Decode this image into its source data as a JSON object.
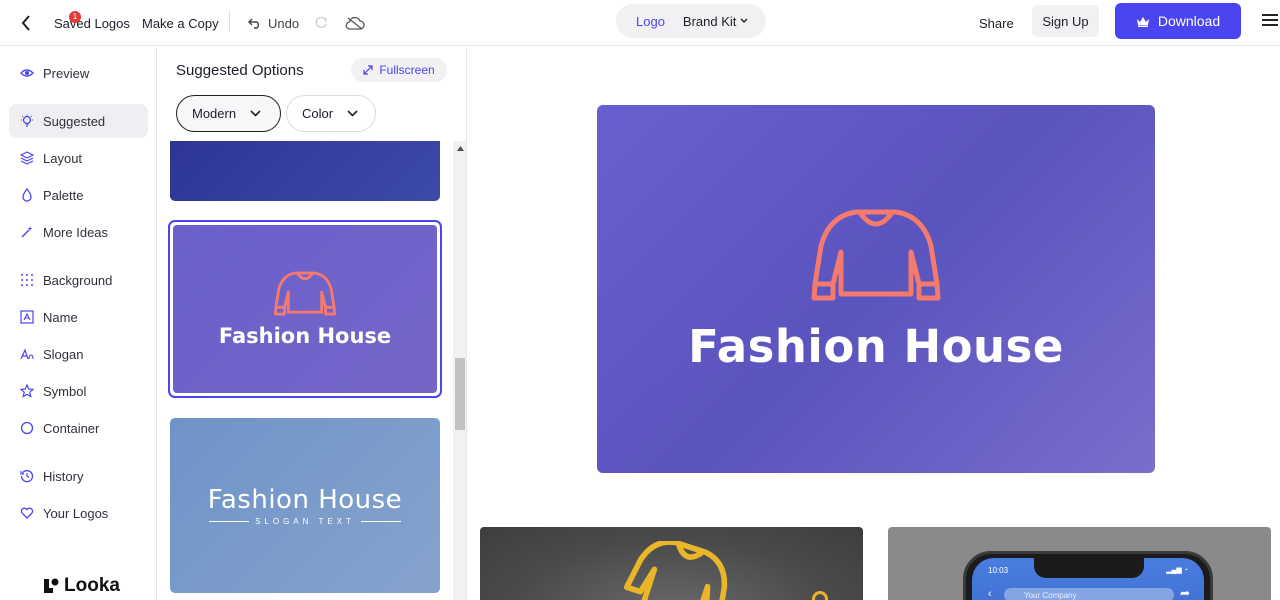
{
  "topbar": {
    "saved_label": "Saved Logos",
    "saved_badge": "1",
    "copy_label": "Make a Copy",
    "undo_label": "Undo",
    "tabs": {
      "logo": "Logo",
      "brand_kit": "Brand Kit"
    },
    "share_label": "Share",
    "signup_label": "Sign Up",
    "download_label": "Download",
    "accent": "#4a45f0"
  },
  "sidebar": {
    "items": [
      {
        "label": "Preview",
        "icon": "eye-icon"
      },
      {
        "label": "Suggested",
        "icon": "bulb-icon",
        "active": true
      },
      {
        "label": "Layout",
        "icon": "layers-icon"
      },
      {
        "label": "Palette",
        "icon": "drop-icon"
      },
      {
        "label": "More Ideas",
        "icon": "wand-icon"
      },
      {
        "label": "Background",
        "icon": "dots-grid-icon"
      },
      {
        "label": "Name",
        "icon": "text-box-icon"
      },
      {
        "label": "Slogan",
        "icon": "slogan-icon"
      },
      {
        "label": "Symbol",
        "icon": "star-icon"
      },
      {
        "label": "Container",
        "icon": "circle-icon"
      },
      {
        "label": "History",
        "icon": "history-icon"
      },
      {
        "label": "Your Logos",
        "icon": "heart-icon"
      }
    ],
    "brand": "Looka"
  },
  "options": {
    "title": "Suggested Options",
    "fullscreen_label": "Fullscreen",
    "style_dropdown": "Modern",
    "color_dropdown": "Color",
    "cards": [
      {
        "name": "Fashion House",
        "selected": true
      },
      {
        "name": "Fashion House",
        "slogan": "SLOGAN TEXT"
      }
    ]
  },
  "preview": {
    "name": "Fashion House",
    "symbol_color": "#f47a6e",
    "bg_color": "#5f57c8"
  },
  "mockups": {
    "phone_time": "10:03",
    "phone_search": "Your Company"
  }
}
